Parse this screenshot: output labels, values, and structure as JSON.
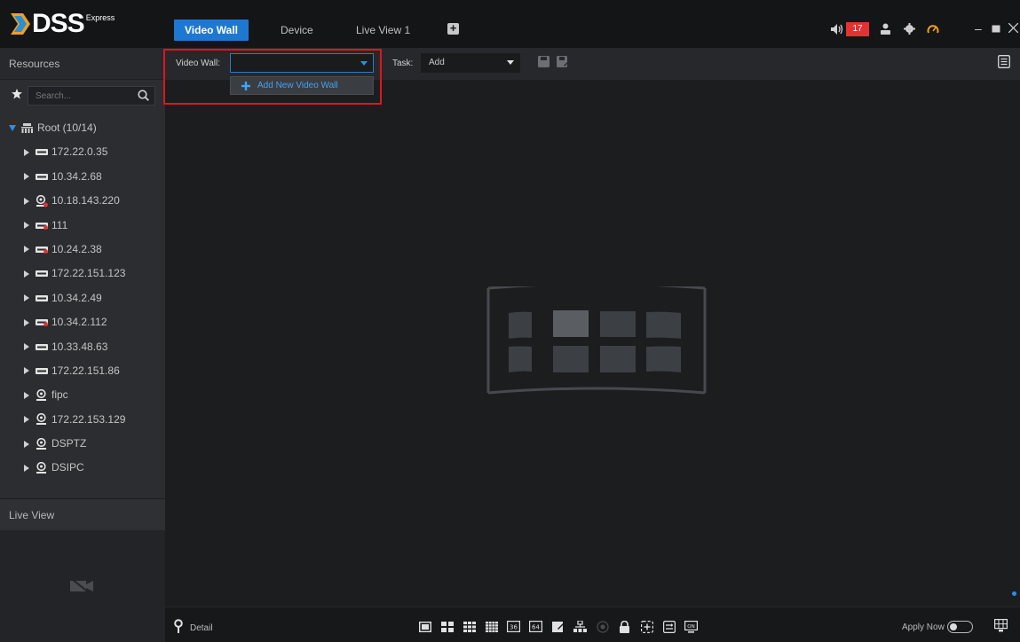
{
  "app": {
    "name": "DSS",
    "edition": "Express"
  },
  "tabs": [
    {
      "label": "Video Wall",
      "active": true
    },
    {
      "label": "Device",
      "active": false
    },
    {
      "label": "Live View 1",
      "active": false
    }
  ],
  "header": {
    "alarm_count": "17",
    "icons": [
      "speaker-icon",
      "user-icon",
      "gear-icon",
      "gauge-icon",
      "minimize-icon",
      "maximize-icon",
      "close-icon"
    ]
  },
  "resources": {
    "title": "Resources",
    "search_placeholder": "Search...",
    "root": {
      "label": "Root (10/14)"
    },
    "devices": [
      {
        "label": "172.22.0.35",
        "icon": "dvr-icon"
      },
      {
        "label": "10.34.2.68",
        "icon": "dvr-icon"
      },
      {
        "label": "10.18.143.220",
        "icon": "camera-alert-icon"
      },
      {
        "label": "111",
        "icon": "dvr-alert-icon"
      },
      {
        "label": "10.24.2.38",
        "icon": "dvr-alert-icon"
      },
      {
        "label": "172.22.151.123",
        "icon": "dvr-icon"
      },
      {
        "label": "10.34.2.49",
        "icon": "dvr-icon"
      },
      {
        "label": "10.34.2.112",
        "icon": "dvr-alert-icon"
      },
      {
        "label": "10.33.48.63",
        "icon": "dvr-icon"
      },
      {
        "label": "172.22.151.86",
        "icon": "dvr-icon"
      },
      {
        "label": "fipc",
        "icon": "camera-icon"
      },
      {
        "label": "172.22.153.129",
        "icon": "camera-icon"
      },
      {
        "label": "DSPTZ",
        "icon": "camera-icon"
      },
      {
        "label": "DSIPC",
        "icon": "camera-icon"
      }
    ]
  },
  "live_view": {
    "title": "Live View"
  },
  "toolbar": {
    "video_wall_label": "Video Wall:",
    "video_wall_value": "",
    "task_label": "Task:",
    "task_value": "Add",
    "dropdown_item": "Add New Video Wall"
  },
  "bottom": {
    "detail_label": "Detail",
    "apply_now_label": "Apply Now",
    "apply_now_on": false
  },
  "colors": {
    "accent": "#1e78d2",
    "badge": "#e23232",
    "highlight_box": "#e1141e",
    "link": "#43a3f5"
  }
}
